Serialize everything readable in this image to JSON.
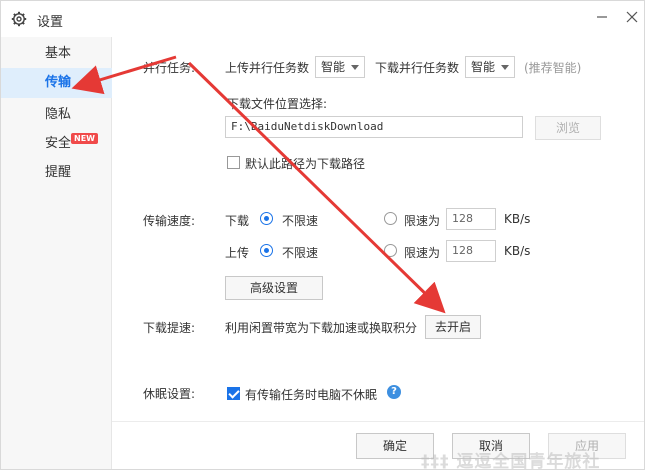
{
  "window": {
    "title": "设置"
  },
  "sidebar": {
    "items": [
      {
        "label": "基本"
      },
      {
        "label": "传输"
      },
      {
        "label": "隐私"
      },
      {
        "label": "安全",
        "badge": "NEW"
      },
      {
        "label": "提醒"
      }
    ],
    "active_index": 1
  },
  "parallel": {
    "label": "并行任务:",
    "upload_label": "上传并行任务数",
    "upload_value": "智能",
    "download_label": "下载并行任务数",
    "download_value": "智能",
    "hint": "(推荐智能)"
  },
  "download_location": {
    "label": "下载文件位置选择:",
    "path": "F:\\BaiduNetdiskDownload",
    "browse_label": "浏览",
    "default_checkbox_label": "默认此路径为下载路径",
    "default_checked": false
  },
  "speed": {
    "label": "传输速度:",
    "download_label": "下载",
    "upload_label": "上传",
    "unlimited_label": "不限速",
    "limit_label": "限速为",
    "download_limit_value": "128",
    "upload_limit_value": "128",
    "unit": "KB/s",
    "advanced_label": "高级设置"
  },
  "boost": {
    "label": "下载提速:",
    "desc": "利用闲置带宽为下载加速或换取积分",
    "button_label": "去开启"
  },
  "sleep": {
    "label": "休眠设置:",
    "checkbox_label": "有传输任务时电脑不休眠",
    "checked": true
  },
  "footer": {
    "ok_label": "确定",
    "cancel_label": "取消",
    "apply_label": "应用"
  },
  "watermark": "‡‡‡ 逗逗全国青年旅社",
  "colors": {
    "accent": "#1a73e8",
    "arrow": "#e53935",
    "badge": "#f04a4a"
  },
  "icons": {
    "title": "gear-icon",
    "minimize": "minimize-icon",
    "close": "close-icon",
    "help": "help-icon",
    "dropdown": "chevron-down-icon"
  }
}
